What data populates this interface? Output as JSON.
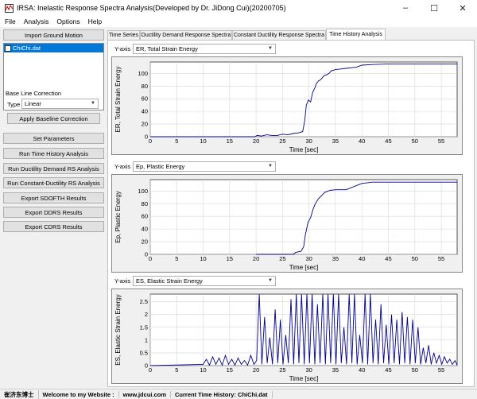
{
  "window": {
    "title": "IRSA: Inelastic Response Spectra Analysis(Developed by Dr. JiDong Cui)(20200705)",
    "minimize": "–",
    "maximize": "☐",
    "close": "✕"
  },
  "menu": {
    "items": [
      "File",
      "Analysis",
      "Options",
      "Help"
    ]
  },
  "left": {
    "import_label": "Import Ground Motion",
    "list_items": [
      "ChiChi.dat"
    ],
    "baseline_heading": "Base Line Correction",
    "type_label": "Type",
    "type_value": "Linear",
    "apply_label": "Apply Baseline Correction",
    "set_params_label": "Set Parameters",
    "run_th_label": "Run Time History Analysis",
    "run_ddrs_label": "Run Ductility Demand RS Analysis",
    "run_cdrs_label": "Run Constant-Ductility RS Analysis",
    "export_sdofth_label": "Export SDOFTH Results",
    "export_ddrs_label": "Export DDRS Results",
    "export_cdrs_label": "Export CDRS Results"
  },
  "tabs": [
    "Time Series",
    "Ductility Demand Response Spectra",
    "Constant Ductility Response Spectra",
    "Time History Analysis"
  ],
  "active_tab": 3,
  "panels": {
    "p1": {
      "yaxis_label": "Y-axis",
      "selected": "ER, Total Strain Energy"
    },
    "p2": {
      "yaxis_label": "Y-axis",
      "selected": "Ep, Plastic Energy"
    },
    "p3": {
      "yaxis_label": "Y-axis",
      "selected": "ES, Elastic Strain Energy"
    }
  },
  "status": {
    "logo": "崔济东博士",
    "welcome": "Welcome to my Website :",
    "website": "www.jdcui.com",
    "current": "Current Time History: ChiChi.dat"
  },
  "colors": {
    "series": "#00008b",
    "selection": "#0078d7"
  },
  "chart_data": [
    {
      "type": "line",
      "ylabel": "ER, Total Strain Energy",
      "xlabel": "Time [sec]",
      "xlim": [
        0,
        58
      ],
      "ylim": [
        0,
        118
      ],
      "xticks": [
        0,
        5,
        10,
        15,
        20,
        25,
        30,
        35,
        40,
        45,
        50,
        55
      ],
      "yticks": [
        0,
        20,
        40,
        60,
        80,
        100
      ],
      "series": [
        {
          "x": [
            0,
            19.8,
            20.2,
            21,
            22,
            23,
            24,
            25,
            26,
            27,
            28,
            28.8,
            29.2,
            29.5,
            29.9,
            30.3,
            30.7,
            31.1,
            31.4,
            31.8,
            32.2,
            32.6,
            33,
            33.4,
            33.8,
            34.2,
            35,
            36,
            37,
            38,
            39,
            40,
            42,
            45,
            50,
            55,
            58
          ],
          "y": [
            0,
            0,
            2,
            1,
            3,
            2,
            2,
            4,
            3,
            5,
            6,
            8,
            25,
            50,
            58,
            55,
            70,
            77,
            84,
            88,
            90,
            94,
            97,
            98,
            100,
            104,
            106,
            107,
            108,
            109,
            110,
            113,
            114,
            115,
            115,
            115,
            115
          ]
        }
      ]
    },
    {
      "type": "line",
      "ylabel": "Ep, Plastic Energy",
      "xlabel": "Time [sec]",
      "xlim": [
        0,
        58
      ],
      "ylim": [
        0,
        118
      ],
      "xticks": [
        0,
        5,
        10,
        15,
        20,
        25,
        30,
        35,
        40,
        45,
        50,
        55
      ],
      "yticks": [
        0,
        20,
        40,
        60,
        80,
        100
      ],
      "series": [
        {
          "x": [
            20,
            27,
            27.5,
            28.5,
            29,
            29.3,
            29.8,
            30.3,
            30.8,
            31.2,
            31.8,
            32.3,
            33,
            34,
            35,
            37,
            40,
            42,
            45,
            55,
            58
          ],
          "y": [
            0,
            0,
            3,
            5,
            12,
            30,
            50,
            58,
            72,
            80,
            88,
            92,
            98,
            101,
            102,
            102,
            112,
            114,
            114,
            114,
            114
          ]
        }
      ]
    },
    {
      "type": "line",
      "ylabel": "ES, Elastic Strain Energy",
      "xlabel": "Time [sec]",
      "xlim": [
        0,
        58
      ],
      "ylim": [
        0,
        2.8
      ],
      "xticks": [
        0,
        5,
        10,
        15,
        20,
        25,
        30,
        35,
        40,
        45,
        50,
        55
      ],
      "yticks": [
        0,
        0.5,
        1,
        1.5,
        2,
        2.5
      ],
      "series": [
        {
          "x": [
            0,
            10,
            10.6,
            11.2,
            11.8,
            12.4,
            13,
            13.6,
            14.2,
            14.8,
            15.4,
            16,
            16.6,
            17.2,
            17.8,
            18.4,
            19,
            19.6,
            20.1,
            20.6,
            21.1,
            21.6,
            22.1,
            22.6,
            23.1,
            23.6,
            24.1,
            24.6,
            25.1,
            25.6,
            26.1,
            26.6,
            27.1,
            27.6,
            28.1,
            28.6,
            29.1,
            29.6,
            30.1,
            30.6,
            31.1,
            31.6,
            32.1,
            32.6,
            33.1,
            33.6,
            34.1,
            34.6,
            35.1,
            35.6,
            36.1,
            36.6,
            37.1,
            37.6,
            38.1,
            38.6,
            39.1,
            39.6,
            40.1,
            40.6,
            41.1,
            41.6,
            42.1,
            42.6,
            43.1,
            43.6,
            44.1,
            44.6,
            45.1,
            45.6,
            46.1,
            46.6,
            47.1,
            47.6,
            48.1,
            48.6,
            49.1,
            49.6,
            50.1,
            50.6,
            51.1,
            51.6,
            52.1,
            52.6,
            53.1,
            53.6,
            54.1,
            54.6,
            55.1,
            55.6,
            56.1,
            56.6,
            57.1,
            57.6,
            58
          ],
          "y": [
            0,
            0.05,
            0.25,
            0.02,
            0.35,
            0.05,
            0.3,
            0.02,
            0.4,
            0.05,
            0.25,
            0.02,
            0.3,
            0.05,
            0.2,
            0.02,
            0.4,
            0.05,
            0.2,
            2.8,
            0.05,
            1.9,
            0.1,
            1.1,
            0.05,
            2.2,
            0.1,
            1.8,
            0.05,
            1.2,
            0.1,
            2.6,
            0.05,
            2.8,
            0.1,
            2.8,
            0.05,
            2.8,
            0.1,
            2.8,
            0.05,
            2.4,
            0.1,
            2.8,
            0.05,
            2.8,
            0.1,
            2.8,
            0.05,
            2.8,
            0.1,
            1.5,
            0.05,
            2.8,
            0.1,
            2.8,
            0.05,
            1.2,
            0.1,
            2.8,
            0.05,
            2.8,
            0.1,
            1.8,
            0.05,
            2.4,
            0.1,
            1.6,
            0.05,
            2.0,
            0.1,
            1.8,
            0.05,
            2.1,
            0.1,
            1.9,
            0.05,
            1.8,
            0.1,
            1.5,
            0.05,
            0.7,
            0.1,
            0.8,
            0.05,
            0.5,
            0.1,
            0.4,
            0.05,
            0.35,
            0.1,
            0.25,
            0.05,
            0.2,
            0.02
          ]
        }
      ]
    }
  ]
}
